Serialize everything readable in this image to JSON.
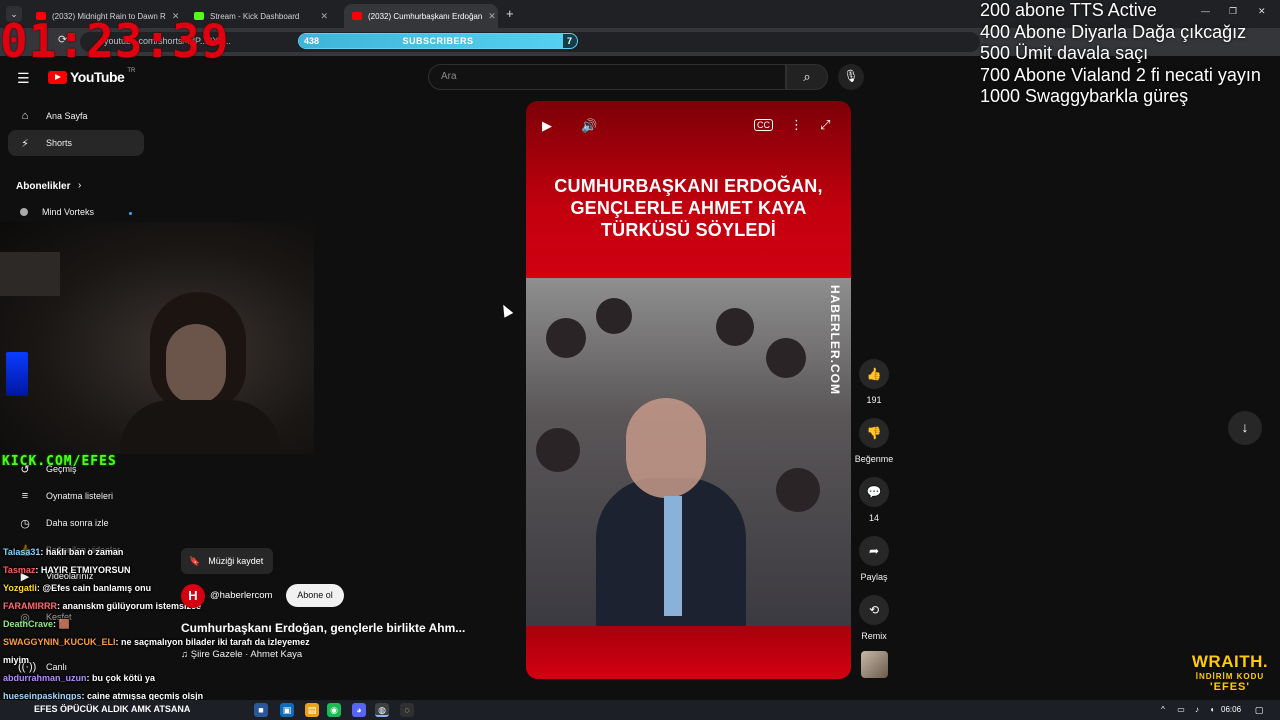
{
  "browser": {
    "tabs": [
      {
        "title": "(2032) Midnight Rain to Dawn R",
        "favicon_color": "#ff0000"
      },
      {
        "title": "Stream - Kick Dashboard",
        "favicon_color": "#53fc18"
      },
      {
        "title": "(2032) Cumhurbaşkanı Erdoğan",
        "favicon_color": "#ff0000"
      }
    ],
    "url": "youtube.com/shorts/4dP...2X3..."
  },
  "overlay": {
    "timer": "01:23:39",
    "subscribers": {
      "current": "438",
      "label": "SUBSCRIBERS",
      "goal": "7",
      "progress": 0.95
    },
    "goals": [
      "200 abone TTS Active",
      "400 Abone Diyarla Dağa çıkcağız",
      "500 Ümit davala saçı",
      "700 Abone Vialand 2 fi necati yayın",
      "1000 Swaggybarkla güreş"
    ],
    "kick_tag": "KICK.COM/EFES",
    "sponsor": {
      "line1": "WRAITH.",
      "line2": "İNDİRİM KODU",
      "line3": "'EFES'"
    }
  },
  "youtube": {
    "logo_text": "YouTube",
    "region": "TR",
    "search_placeholder": "Ara",
    "sidebar": {
      "items": [
        {
          "label": "Ana Sayfa",
          "icon": "home-icon"
        },
        {
          "label": "Shorts",
          "icon": "shorts-icon"
        }
      ],
      "subs_header": "Abonelikler",
      "subs": [
        {
          "label": "Mind Vorteks"
        }
      ],
      "lower_items": [
        {
          "label": "Geçmiş",
          "icon": "history-icon"
        },
        {
          "label": "Oynatma listeleri",
          "icon": "playlist-icon"
        },
        {
          "label": "Daha sonra izle",
          "icon": "clock-icon"
        },
        {
          "label": "Beğenilen videolar",
          "icon": "like-icon"
        },
        {
          "label": "Videolarınız",
          "icon": "video-icon"
        },
        {
          "label": "Keşfet",
          "icon": "explore-icon"
        },
        {
          "label": "Canlı",
          "icon": "live-icon"
        }
      ]
    },
    "short": {
      "headline": "CUMHURBAŞKANI ERDOĞAN, GENÇLERLE AHMET KAYA TÜRKÜSÜ SÖYLEDİ",
      "watermark": "HABERLER.COM",
      "save_music_label": "Müziği kaydet",
      "channel_initial": "H",
      "channel_handle": "@haberlercom",
      "subscribe_label": "Abone ol",
      "title": "Cumhurbaşkanı Erdoğan, gençlerle birlikte Ahm...",
      "sound": "♫ Şiire Gazele · Ahmet Kaya",
      "actions": {
        "likes": "191",
        "dislike_label": "Beğenme",
        "comments": "14",
        "share_label": "Paylaş",
        "remix_label": "Remix"
      }
    }
  },
  "chat": [
    {
      "user": "Talasa31",
      "user_color": "#7fd6ff",
      "msg": ": haklı ban o zaman"
    },
    {
      "user": "Tasmaz",
      "user_color": "#ff5f5f",
      "msg": ": HAYIR ETMIYORSUN"
    },
    {
      "user": "Yozgatli",
      "user_color": "#ffdd33",
      "msg": ": @Efes cain banlamış onu"
    },
    {
      "user": "FARAMIRRR",
      "user_color": "#ff6b6b",
      "msg": ": ananıskm gülüyorum istemsizce"
    },
    {
      "user": "DeathCrave",
      "user_color": "#8af07a",
      "msg": ": 🟫"
    },
    {
      "user": "SWAGGYNIN_KUCUK_ELI",
      "user_color": "#ff9d3a",
      "msg": ": ne saçmalıyon bilader iki tarafı da izleyemez"
    },
    {
      "user": "",
      "user_color": "#ffffff",
      "msg": "miyim"
    },
    {
      "user": "abdurrahman_uzun",
      "user_color": "#b58cff",
      "msg": ": bu çok kötü ya"
    },
    {
      "user": "hueseinpaskingps",
      "user_color": "#9fd8ff",
      "msg": ": caine atmışsa geçmiş olsjn"
    }
  ],
  "taskbar": {
    "ticker": "EFES ÖPÜCÜK ALDIK AMK ATSANA",
    "clock": "06:06"
  }
}
